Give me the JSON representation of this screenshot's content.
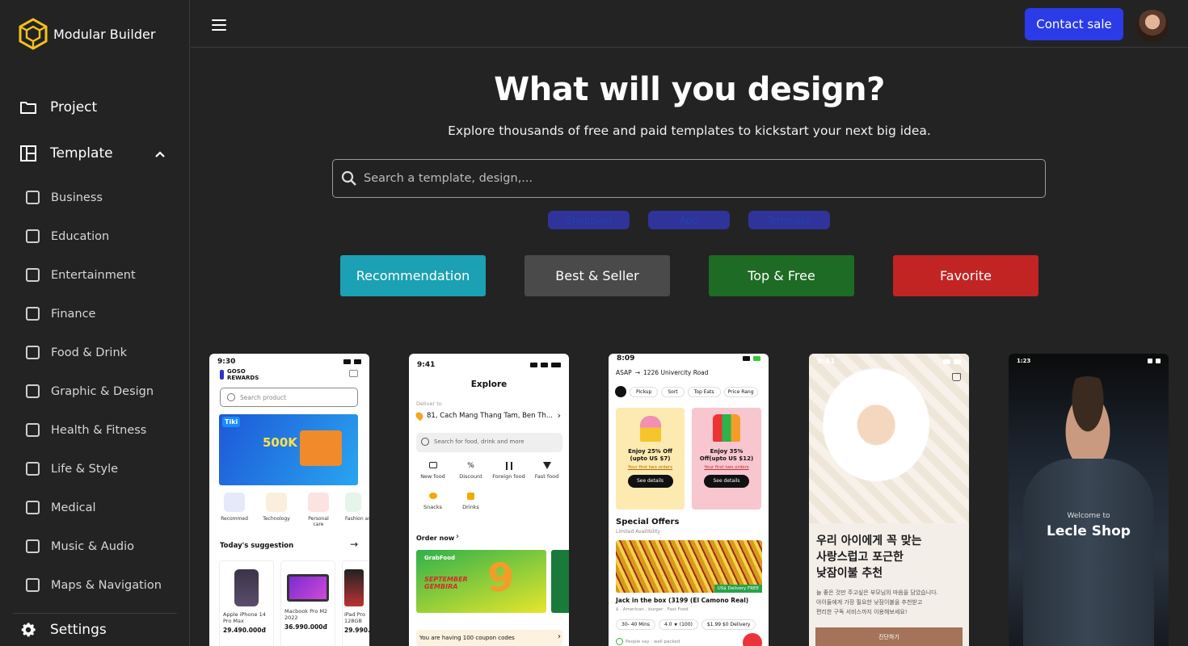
{
  "brand": {
    "name": "Modular Builder",
    "logo_icon": "cube-icon"
  },
  "sidebar": {
    "main": [
      {
        "label": "Project",
        "icon": "folder-icon"
      },
      {
        "label": "Template",
        "icon": "layout-icon"
      }
    ],
    "categories": [
      "Business",
      "Education",
      "Entertainment",
      "Finance",
      "Food & Drink",
      "Graphic & Design",
      "Health & Fitness",
      "Life & Style",
      "Medical",
      "Music & Audio",
      "Maps & Navigation"
    ],
    "settings": "Settings"
  },
  "topbar": {
    "contact": "Contact sale"
  },
  "hero": {
    "title": "What will you design?",
    "subtitle": "Explore thousands of free and paid templates to kickstart your next big idea."
  },
  "search": {
    "placeholder": "Search a template, design,..."
  },
  "chips": [
    "Shopping",
    "App",
    "Template"
  ],
  "filters": [
    {
      "label": "Recommendation",
      "color": "#1ba1b3"
    },
    {
      "label": "Best & Seller",
      "color": "#4a4a4a"
    },
    {
      "label": "Top & Free",
      "color": "#1d6b24"
    },
    {
      "label": "Favorite",
      "color": "#c22424"
    }
  ],
  "cards": {
    "c1": {
      "time": "9:30",
      "brand": "GOSO REWARDS",
      "search": "Search product",
      "banner_big": "500K",
      "banner_tag": "Tiki",
      "cats": [
        "Recommed",
        "Technology",
        "Personal care",
        "Fashion an"
      ],
      "section": "Today's suggestion",
      "products": [
        {
          "name": "Apple iPhone 14 Pro Max",
          "price": "29.490.000đ"
        },
        {
          "name": "Macbook Pro M2 2022",
          "price": "36.990.000đ"
        },
        {
          "name": "iPad Pro 128GB",
          "price": "29.990.0"
        }
      ]
    },
    "c2": {
      "time": "9:41",
      "title": "Explore",
      "deliver_to": "Deliver to",
      "address": "81, Cach Mang Thang Tam, Ben Th...",
      "search": "Search for food, drink and more",
      "cats": [
        "New food",
        "Discount",
        "Foreign food",
        "Fast food",
        "Snacks",
        "Drinks"
      ],
      "order": "Order now",
      "banner_brand": "GrabFood",
      "banner_text": "SEPTEMBER GEMBIRA",
      "coupon": "You are having 100 coupon codes"
    },
    "c3": {
      "time": "8:09",
      "addr_from": "ASAP",
      "addr_to": "1226 Univercity Road",
      "filters": [
        "Pickup",
        "Sort",
        "Top Eats",
        "Price Rang"
      ],
      "promos": [
        {
          "title": "Enjoy 25% Off (upto US $7)",
          "sub": "Your first two orders",
          "btn": "See details"
        },
        {
          "title": "Enjoy 35% Off(upto US $12)",
          "sub": "Your first two orders",
          "btn": "See details"
        }
      ],
      "section": "Special Offers",
      "section_sub": "Limited Availibility",
      "badge": "US$ Delivery FREE",
      "restaurant": "Jack in the box (3199 (El Camono Real)",
      "meta": "$ . American . burger . Fast Food",
      "stats": [
        "30- 40 Mins",
        "4.0 ★ (100)",
        "$1.99 $0 Delivery"
      ],
      "footer": "People say : well packed"
    },
    "c4": {
      "time": "9:41",
      "headline": [
        "우리 아이에게 꼭 맞는",
        "사랑스럽고 포근한",
        "낮잠이불 추천"
      ],
      "body": [
        "늘 좋은 것만 주고싶은 부모님의 마음을 담았습니다.",
        "아이들에게 가장 필요한 낮잠이불을 추천받고",
        "편리한 구독 서비스까지 이용해보세요!"
      ],
      "cta": "진단하기"
    },
    "c5": {
      "time": "1:23",
      "welcome": "Welcome to",
      "shop": "Lecle Shop"
    }
  }
}
